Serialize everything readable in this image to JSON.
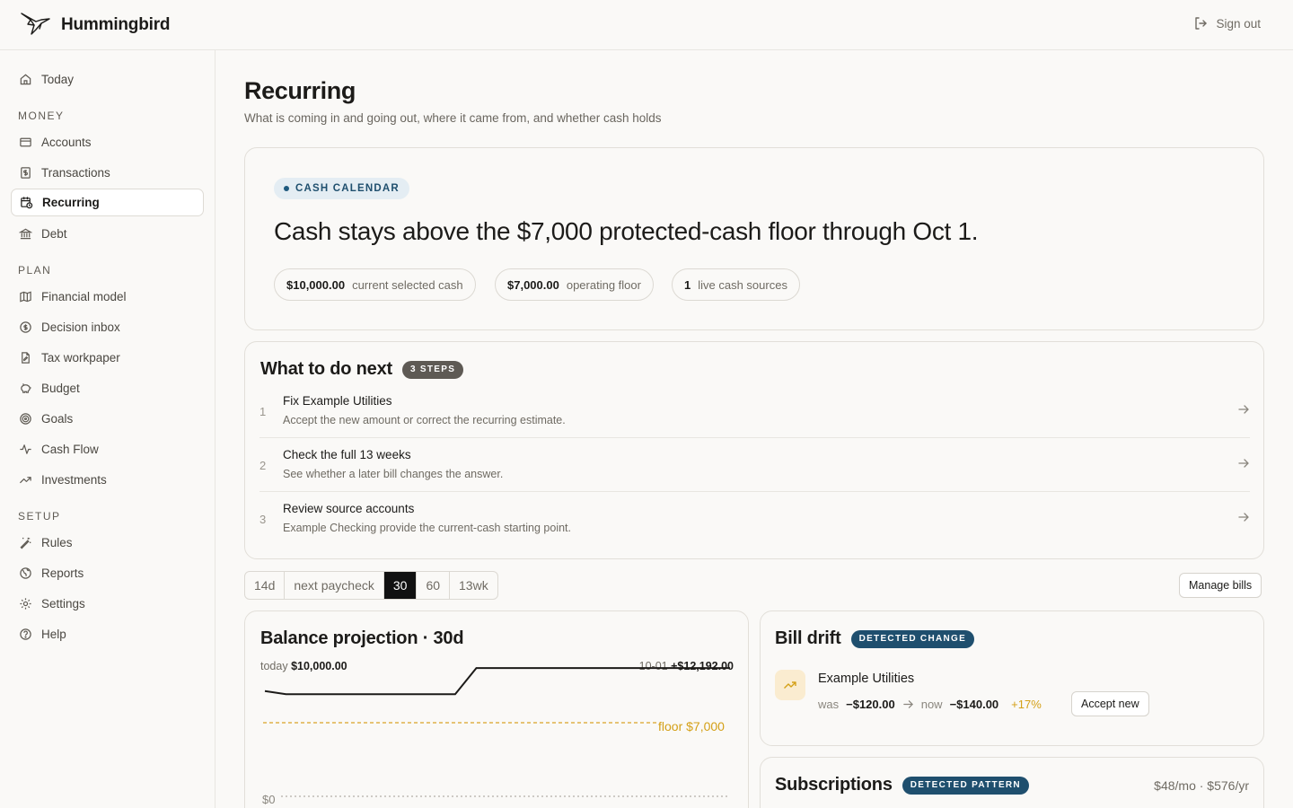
{
  "app": {
    "name": "Hummingbird",
    "sign_out": "Sign out"
  },
  "sidebar": {
    "today": "Today",
    "money_label": "MONEY",
    "money": [
      "Accounts",
      "Transactions",
      "Recurring",
      "Debt"
    ],
    "plan_label": "PLAN",
    "plan": [
      "Financial model",
      "Decision inbox",
      "Tax workpaper",
      "Budget",
      "Goals",
      "Cash Flow",
      "Investments"
    ],
    "setup_label": "SETUP",
    "setup": [
      "Rules",
      "Reports",
      "Settings",
      "Help"
    ],
    "active": "Recurring"
  },
  "page": {
    "title": "Recurring",
    "subtitle": "What is coming in and going out, where it came from, and whether cash holds"
  },
  "cash_calendar": {
    "tag": "CASH CALENDAR",
    "headline": "Cash stays above the $7,000 protected-cash floor through Oct 1.",
    "chips": [
      {
        "value": "$10,000.00",
        "label": "current selected cash"
      },
      {
        "value": "$7,000.00",
        "label": "operating floor"
      },
      {
        "value": "1",
        "label": "live cash sources"
      }
    ]
  },
  "next_steps": {
    "title": "What to do next",
    "badge": "3 STEPS",
    "steps": [
      {
        "num": "1",
        "title": "Fix Example Utilities",
        "desc": "Accept the new amount or correct the recurring estimate."
      },
      {
        "num": "2",
        "title": "Check the full 13 weeks",
        "desc": "See whether a later bill changes the answer."
      },
      {
        "num": "3",
        "title": "Review source accounts",
        "desc": "Example Checking provide the current-cash starting point."
      }
    ]
  },
  "range_tabs": {
    "options": [
      "14d",
      "next paycheck",
      "30",
      "60",
      "13wk"
    ],
    "selected": "30"
  },
  "manage_bills": "Manage bills",
  "projection": {
    "title": "Balance projection · 30d",
    "start_label": "today",
    "start_value": "$10,000.00",
    "end_label": "10-01",
    "end_value": "+$12,192.00",
    "floor_label": "floor $7,000",
    "zero_label": "$0"
  },
  "chart_data": {
    "type": "line",
    "series": [
      {
        "values": [
          10000,
          9700,
          9700,
          9700,
          9700,
          9700,
          9700,
          9700,
          9700,
          9700,
          12192,
          12192,
          12192,
          12192,
          12192,
          12192,
          12192,
          12192,
          12192,
          12192,
          12192,
          12192,
          12192
        ]
      }
    ],
    "floor": 7000,
    "ylim": [
      0,
      12800
    ]
  },
  "bill_drift": {
    "title": "Bill drift",
    "badge": "DETECTED CHANGE",
    "name": "Example Utilities",
    "was_label": "was",
    "was_value": "−$120.00",
    "now_label": "now",
    "now_value": "−$140.00",
    "change": "+17%",
    "accept": "Accept new",
    "icon": "trend-up-icon",
    "accent": "#d4a017"
  },
  "subscriptions": {
    "title": "Subscriptions",
    "badge": "DETECTED PATTERN",
    "summary": "$48/mo · $576/yr"
  }
}
